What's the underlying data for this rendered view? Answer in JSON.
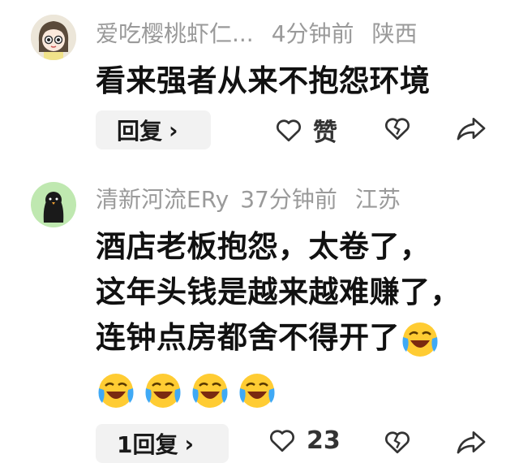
{
  "comments": [
    {
      "username": "爱吃樱桃虾仁...",
      "time": "4分钟前",
      "location": "陕西",
      "text_lines": [
        "看来强者从来不抱怨环境"
      ],
      "reply_label": "回复",
      "like_label": "赞",
      "avatar_icon": "girl-cartoon-avatar-icon"
    },
    {
      "username": "清新河流ERy",
      "time": "37分钟前",
      "location": "江苏",
      "text_lines": [
        "酒店老板抱怨，太卷了，",
        "这年头钱是越来越难赚了，",
        "连钟点房都舍不得开了"
      ],
      "emoji_icon": "laughing-crying-emoji-icon",
      "reply_label": "1回复",
      "like_count": "23",
      "avatar_icon": "black-bird-avatar-icon"
    }
  ],
  "colors": {
    "meta_text": "#9a9a9a",
    "body_text": "#111111",
    "reply_bg": "#f2f2f2",
    "avatar2_bg": "#bfe8b0"
  }
}
